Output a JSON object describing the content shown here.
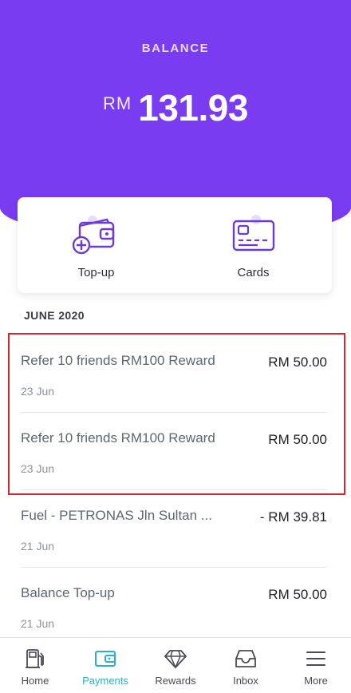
{
  "header": {
    "balance_label": "BALANCE",
    "currency": "RM",
    "amount": "131.93",
    "background_color": "#7a3cf1"
  },
  "actions": [
    {
      "label": "Top-up",
      "icon": "wallet-add-icon"
    },
    {
      "label": "Cards",
      "icon": "card-icon"
    }
  ],
  "section": {
    "title": "JUNE 2020"
  },
  "transactions": [
    {
      "title": "Refer 10 friends RM100 Reward",
      "date": "23 Jun",
      "amount": "RM 50.00"
    },
    {
      "title": "Refer 10 friends RM100 Reward",
      "date": "23 Jun",
      "amount": "RM 50.00"
    },
    {
      "title": "Fuel - PETRONAS Jln Sultan ...",
      "date": "21 Jun",
      "amount": "- RM 39.81"
    },
    {
      "title": "Balance Top-up",
      "date": "21 Jun",
      "amount": "RM 50.00"
    }
  ],
  "highlight_color": "#d9232d",
  "nav": {
    "active_color": "#2bb0c9",
    "items": [
      {
        "label": "Home",
        "icon": "fuel-pump-icon"
      },
      {
        "label": "Payments",
        "icon": "wallet-icon",
        "active": true
      },
      {
        "label": "Rewards",
        "icon": "diamond-icon"
      },
      {
        "label": "Inbox",
        "icon": "inbox-icon"
      },
      {
        "label": "More",
        "icon": "menu-icon"
      }
    ]
  }
}
